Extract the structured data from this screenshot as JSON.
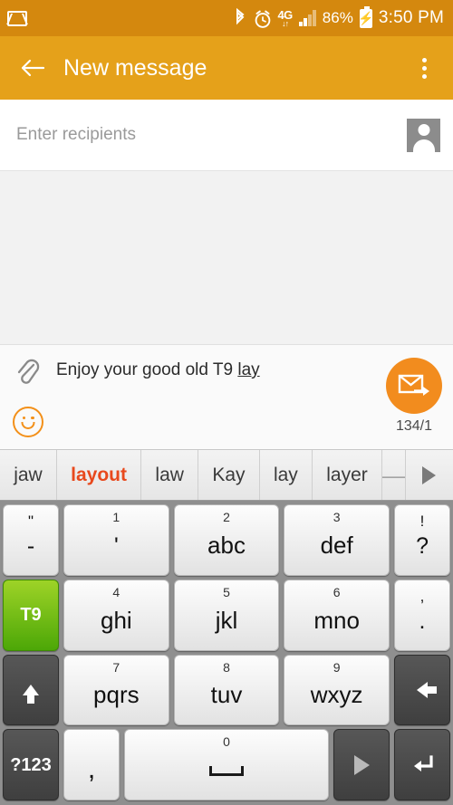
{
  "statusbar": {
    "gmail_icon": "gmail-icon",
    "bluetooth_icon": "bluetooth-icon",
    "alarm_icon": "alarm-icon",
    "network_type": "4G",
    "network_arrows": "↓↑",
    "signal_icon": "signal-bars-icon",
    "battery_percent": "86%",
    "battery_icon": "battery-charging-icon",
    "time": "3:50 PM"
  },
  "appbar": {
    "back_icon": "back-arrow-icon",
    "title": "New message",
    "overflow_icon": "overflow-menu-icon",
    "background": "#e5a11a"
  },
  "recipients": {
    "placeholder": "Enter recipients",
    "value": "",
    "contact_picker_icon": "contact-picker-icon"
  },
  "compose": {
    "attach_icon": "paperclip-icon",
    "emoji_icon": "smiley-icon",
    "message_committed": "Enjoy your good old T9 ",
    "message_composing": "lay",
    "send_icon": "send-message-icon",
    "char_count": "134/1",
    "send_color": "#f28c1e"
  },
  "suggestions": {
    "items": [
      {
        "label": "jaw",
        "selected": false
      },
      {
        "label": "layout",
        "selected": true
      },
      {
        "label": "law",
        "selected": false
      },
      {
        "label": "Kay",
        "selected": false
      },
      {
        "label": "lay",
        "selected": false
      },
      {
        "label": "layer",
        "selected": false
      },
      {
        "label": "⸺",
        "selected": false
      }
    ],
    "expand_icon": "expand-suggestions-icon",
    "highlight_color": "#e8491d"
  },
  "keyboard": {
    "t9_label": "T9",
    "t9_active_color": "#4ca707",
    "symbols_label": "?123",
    "rows": [
      [
        {
          "name": "key-quote-dash",
          "sub": "\"",
          "main": "-",
          "type": "punct"
        },
        {
          "name": "key-1",
          "sub": "1",
          "main": "'",
          "type": "punct"
        },
        {
          "name": "key-2",
          "sub": "2",
          "main": "abc",
          "type": "letter"
        },
        {
          "name": "key-3",
          "sub": "3",
          "main": "def",
          "type": "letter"
        },
        {
          "name": "key-exclaim-question",
          "sub": "!",
          "main": "?",
          "type": "punct"
        }
      ],
      [
        {
          "name": "key-t9",
          "sub": "",
          "main": "T9",
          "type": "green"
        },
        {
          "name": "key-4",
          "sub": "4",
          "main": "ghi",
          "type": "letter"
        },
        {
          "name": "key-5",
          "sub": "5",
          "main": "jkl",
          "type": "letter"
        },
        {
          "name": "key-6",
          "sub": "6",
          "main": "mno",
          "type": "letter"
        },
        {
          "name": "key-comma-period",
          "sub": ",",
          "main": ".",
          "type": "punct"
        }
      ],
      [
        {
          "name": "key-shift",
          "sub": "",
          "main": "",
          "type": "shift"
        },
        {
          "name": "key-7",
          "sub": "7",
          "main": "pqrs",
          "type": "letter"
        },
        {
          "name": "key-8",
          "sub": "8",
          "main": "tuv",
          "type": "letter"
        },
        {
          "name": "key-9",
          "sub": "9",
          "main": "wxyz",
          "type": "letter"
        },
        {
          "name": "key-backspace",
          "sub": "",
          "main": "",
          "type": "backspace"
        }
      ],
      [
        {
          "name": "key-symbols",
          "sub": "",
          "main": "?123",
          "type": "dark-label"
        },
        {
          "name": "key-comma",
          "sub": "",
          "main": ",",
          "type": "comma"
        },
        {
          "name": "key-space",
          "sub": "0",
          "main": "",
          "type": "space"
        },
        {
          "name": "key-next",
          "sub": "",
          "main": "",
          "type": "next"
        },
        {
          "name": "key-enter",
          "sub": "",
          "main": "",
          "type": "enter"
        }
      ]
    ]
  }
}
